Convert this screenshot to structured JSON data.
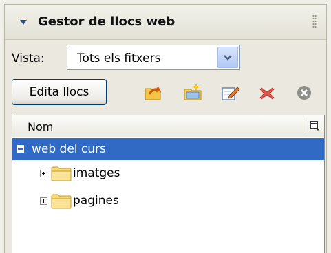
{
  "panel": {
    "title": "Gestor de llocs web",
    "collapse_icon": "triangle-down-icon",
    "grip_icon": "grip-dots-icon"
  },
  "view": {
    "label": "Vista:",
    "selected": "Tots els fitxers",
    "dropdown_icon": "chevron-down-icon"
  },
  "toolbar": {
    "edit_label": "Edita llocs",
    "icons": [
      "connect-icon",
      "new-folder-icon",
      "edit-icon",
      "delete-icon",
      "cancel-icon"
    ]
  },
  "tree": {
    "column_header": "Nom",
    "options_icon": "column-options-icon",
    "root": {
      "label": "web del curs",
      "expanded": true
    },
    "children": [
      {
        "label": "imatges",
        "icon": "folder-icon",
        "expanded": false
      },
      {
        "label": "pagines",
        "icon": "folder-icon",
        "expanded": false
      }
    ]
  },
  "colors": {
    "selection": "#316ac5",
    "title_accent": "#2d4c8c",
    "panel_bg": "#ebe9df"
  }
}
